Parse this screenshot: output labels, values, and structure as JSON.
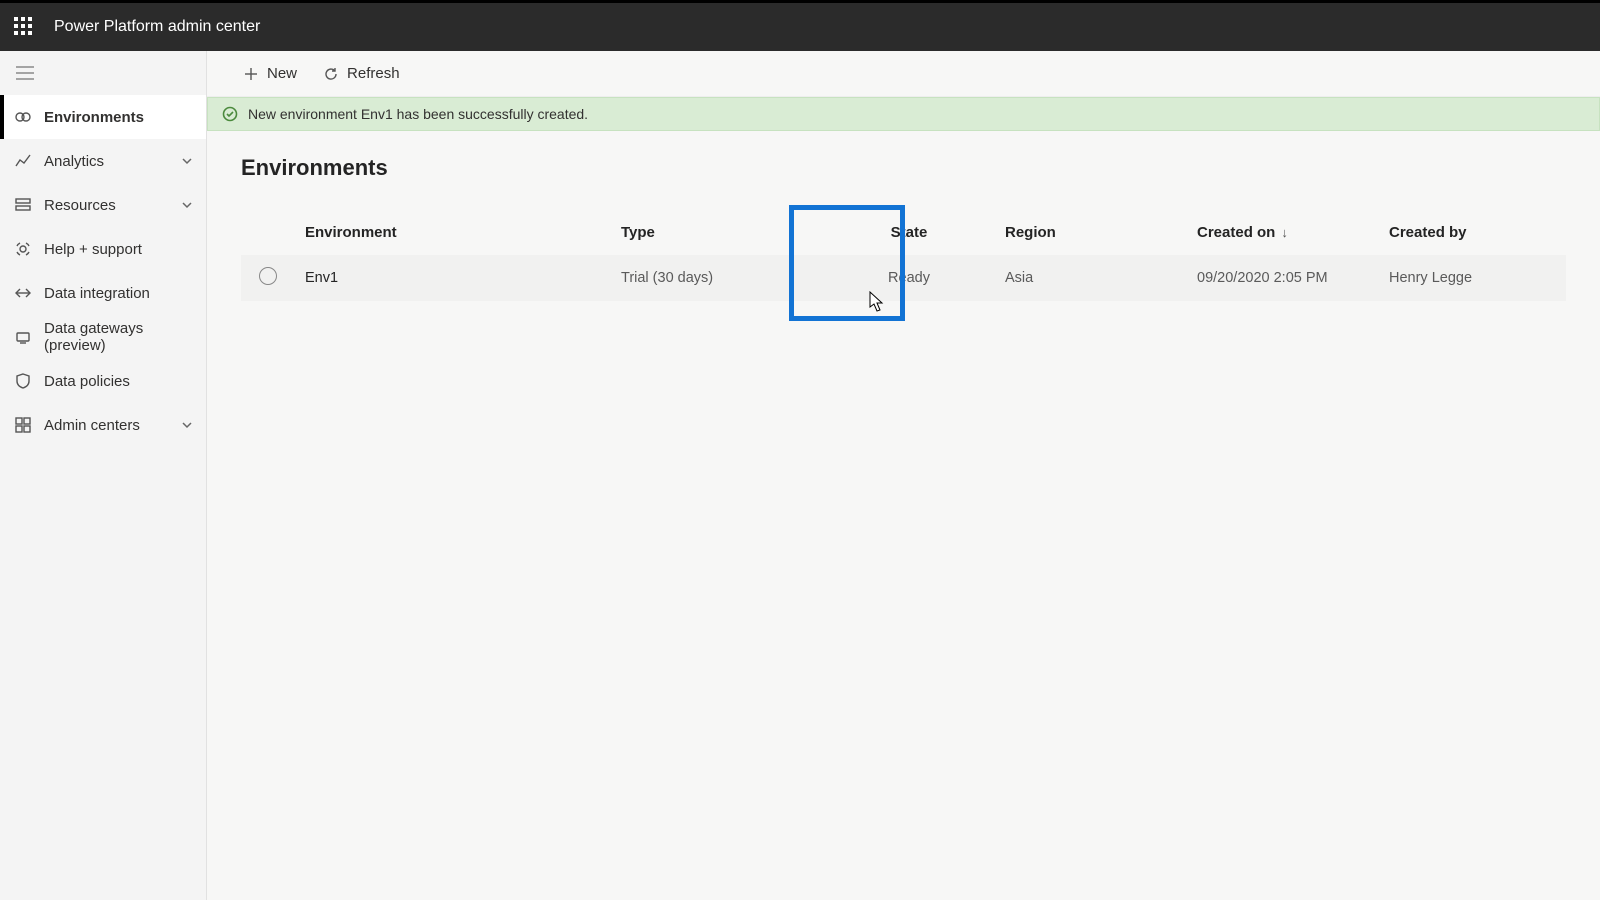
{
  "header": {
    "title": "Power Platform admin center"
  },
  "sidebar": {
    "items": [
      {
        "label": "Environments",
        "icon": "environments",
        "selected": true
      },
      {
        "label": "Analytics",
        "icon": "analytics",
        "expandable": true
      },
      {
        "label": "Resources",
        "icon": "resources",
        "expandable": true
      },
      {
        "label": "Help + support",
        "icon": "help",
        "expandable": false
      },
      {
        "label": "Data integration",
        "icon": "data-integration",
        "expandable": false
      },
      {
        "label": "Data gateways (preview)",
        "icon": "gateways",
        "expandable": false
      },
      {
        "label": "Data policies",
        "icon": "policies",
        "expandable": false
      },
      {
        "label": "Admin centers",
        "icon": "admin-centers",
        "expandable": true
      }
    ]
  },
  "toolbar": {
    "new_label": "New",
    "refresh_label": "Refresh"
  },
  "banner": {
    "message": "New environment Env1 has been successfully created."
  },
  "page": {
    "title": "Environments"
  },
  "table": {
    "columns": {
      "environment": "Environment",
      "type": "Type",
      "state": "State",
      "region": "Region",
      "created_on": "Created on",
      "created_by": "Created by"
    },
    "sort": {
      "column": "created_on",
      "dir": "desc"
    },
    "rows": [
      {
        "environment": "Env1",
        "type": "Trial (30 days)",
        "state": "Ready",
        "region": "Asia",
        "created_on": "09/20/2020 2:05 PM",
        "created_by": "Henry Legge"
      }
    ]
  },
  "highlight": {
    "column": "state"
  }
}
